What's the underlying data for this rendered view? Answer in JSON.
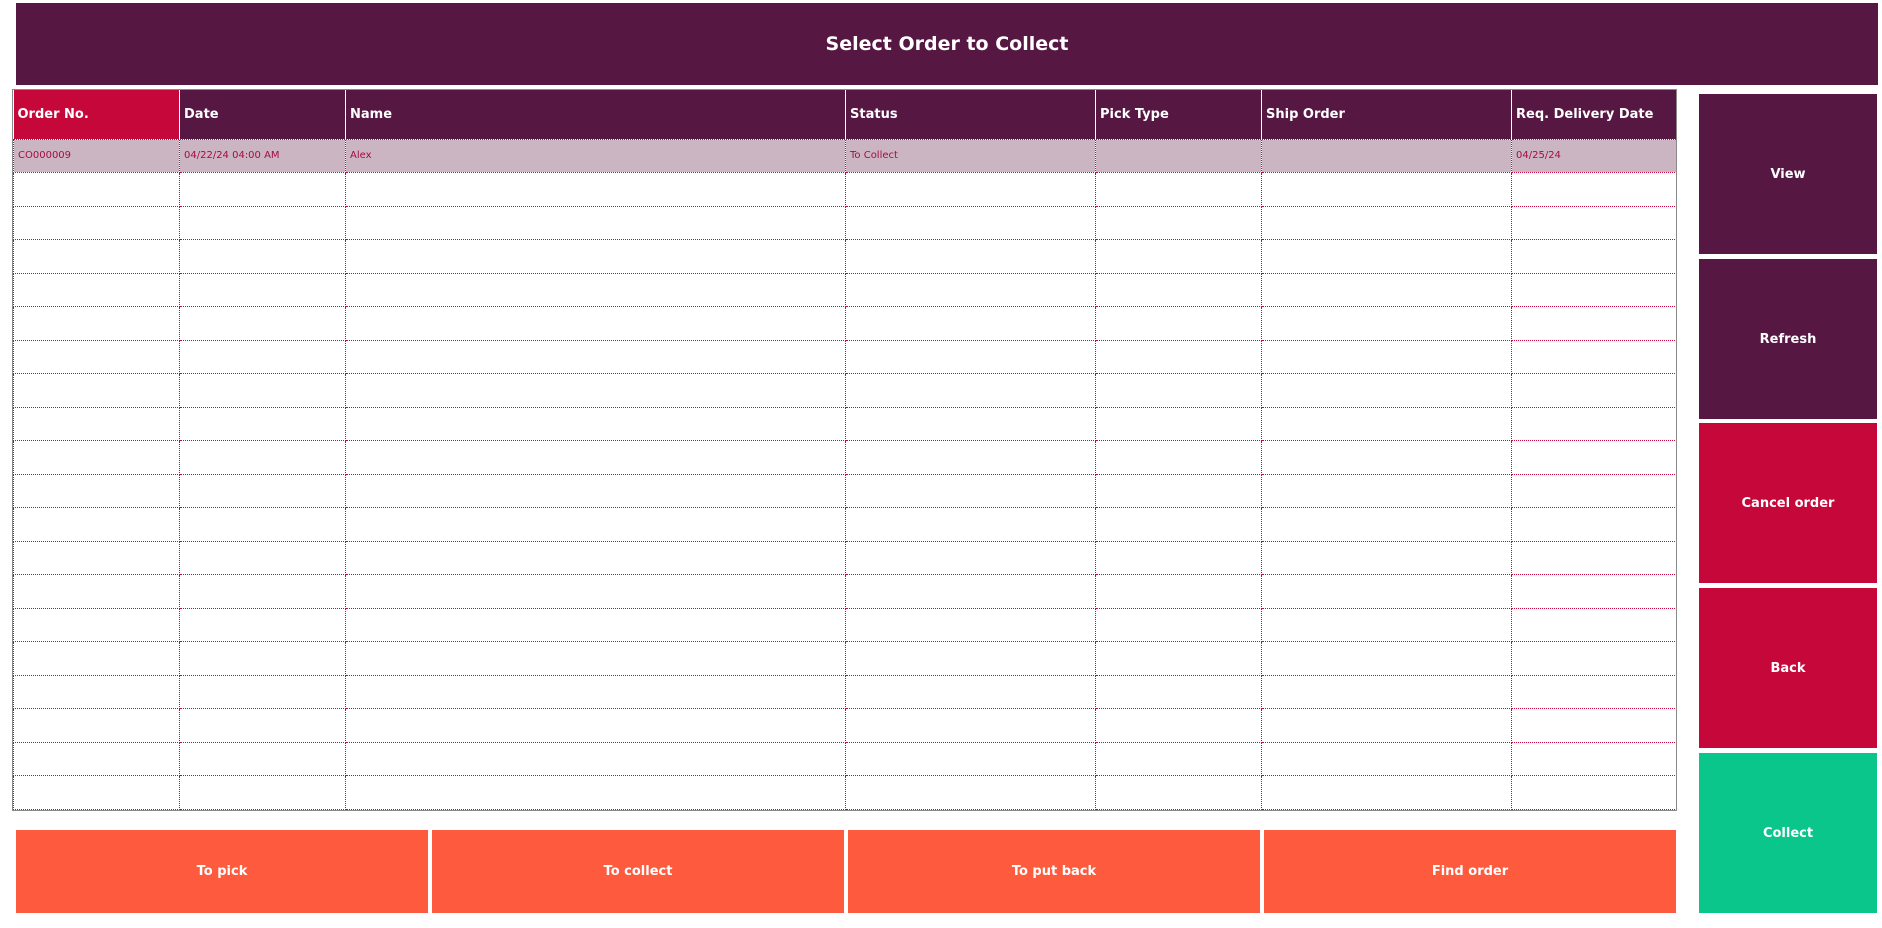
{
  "header": {
    "title": "Select Order to Collect"
  },
  "table": {
    "columns": [
      "Order No.",
      "Date",
      "Name",
      "Status",
      "Pick Type",
      "Ship Order",
      "Req. Delivery Date"
    ],
    "rows": [
      [
        "CO000009",
        "04/22/24 04:00 AM",
        "Alex",
        "To Collect",
        "",
        "",
        "04/25/24"
      ]
    ],
    "empty_rows": 19
  },
  "sidebar": {
    "view_label": "View",
    "refresh_label": "Refresh",
    "cancel_label": "Cancel order",
    "back_label": "Back",
    "collect_label": "Collect"
  },
  "footer": {
    "to_pick_label": "To pick",
    "to_collect_label": "To collect",
    "to_put_back_label": "To put back",
    "find_order_label": "Find order"
  },
  "colors": {
    "primary": "#561843",
    "accent": "#c5073a",
    "action": "#fe5b3e",
    "success": "#0bc68b",
    "selected_row": "#cbb5c2"
  }
}
